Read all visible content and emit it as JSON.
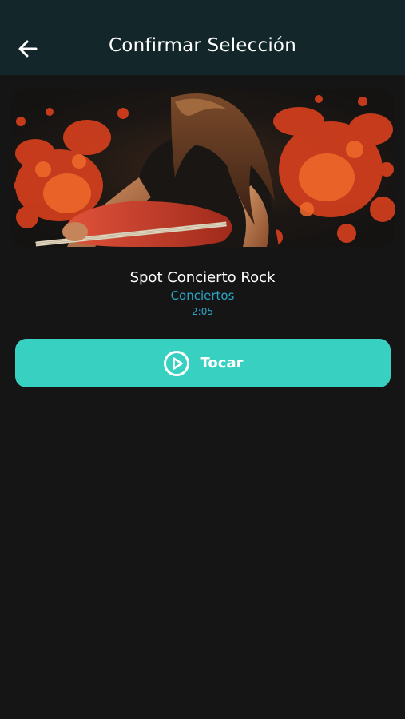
{
  "app_bar": {
    "title": "Confirmar Selección",
    "back_icon": "arrow-left-icon",
    "background_color": "#13262a"
  },
  "hero_image": {
    "description": "rock-guitarist-artwork"
  },
  "track": {
    "title": "Spot Concierto Rock",
    "category": "Conciertos",
    "duration": "2:05",
    "accent_color": "#2aa5c6"
  },
  "play_button": {
    "label": "Tocar",
    "icon": "play-circle-icon",
    "color": "#38d1c1"
  },
  "theme": {
    "background": "#151515"
  }
}
